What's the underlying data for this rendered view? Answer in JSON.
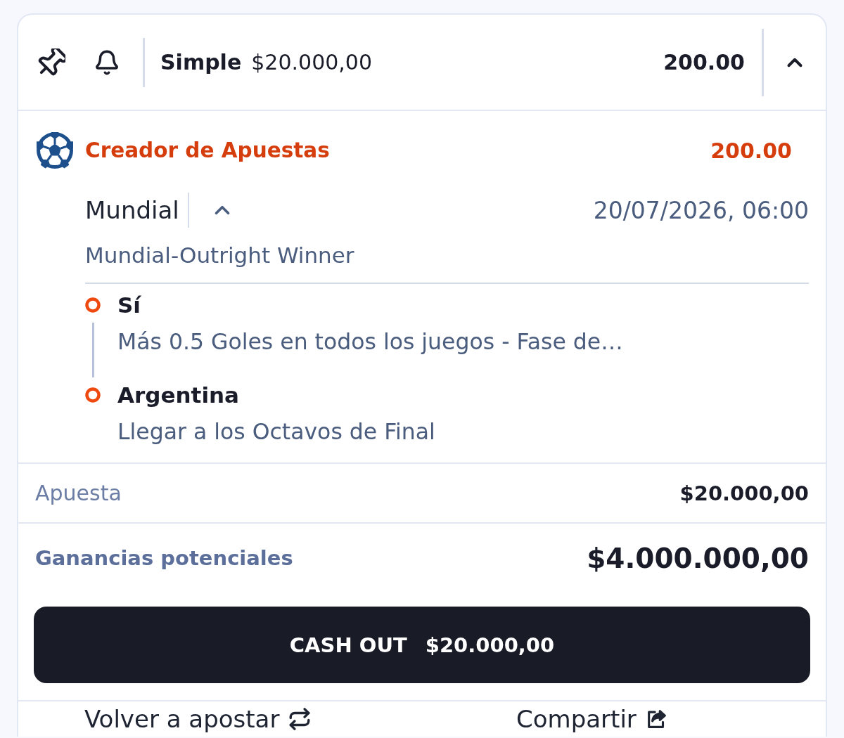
{
  "header": {
    "bet_type": "Simple",
    "stake": "$20.000,00",
    "odds": "200.00",
    "expanded": true
  },
  "bet_builder": {
    "title": "Creador de Apuestas",
    "odds": "200.00",
    "event": {
      "name": "Mundial",
      "expanded": true,
      "datetime": "20/07/2026, 06:00",
      "market": "Mundial-Outright Winner"
    },
    "legs": [
      {
        "selection": "Sí",
        "market": "Más 0.5 Goles en todos los juegos - Fase de…"
      },
      {
        "selection": "Argentina",
        "market": "Llegar a los Octavos de Final"
      }
    ]
  },
  "stake_row": {
    "label": "Apuesta",
    "value": "$20.000,00"
  },
  "potential_winnings": {
    "label": "Ganancias potenciales",
    "value": "$4.000.000,00"
  },
  "cash_out_button": {
    "label": "CASH OUT",
    "amount": "$20.000,00"
  },
  "footer_actions": [
    {
      "kind": "rebet",
      "label": "Volver a apostar"
    },
    {
      "kind": "share",
      "label": "Compartir"
    }
  ]
}
